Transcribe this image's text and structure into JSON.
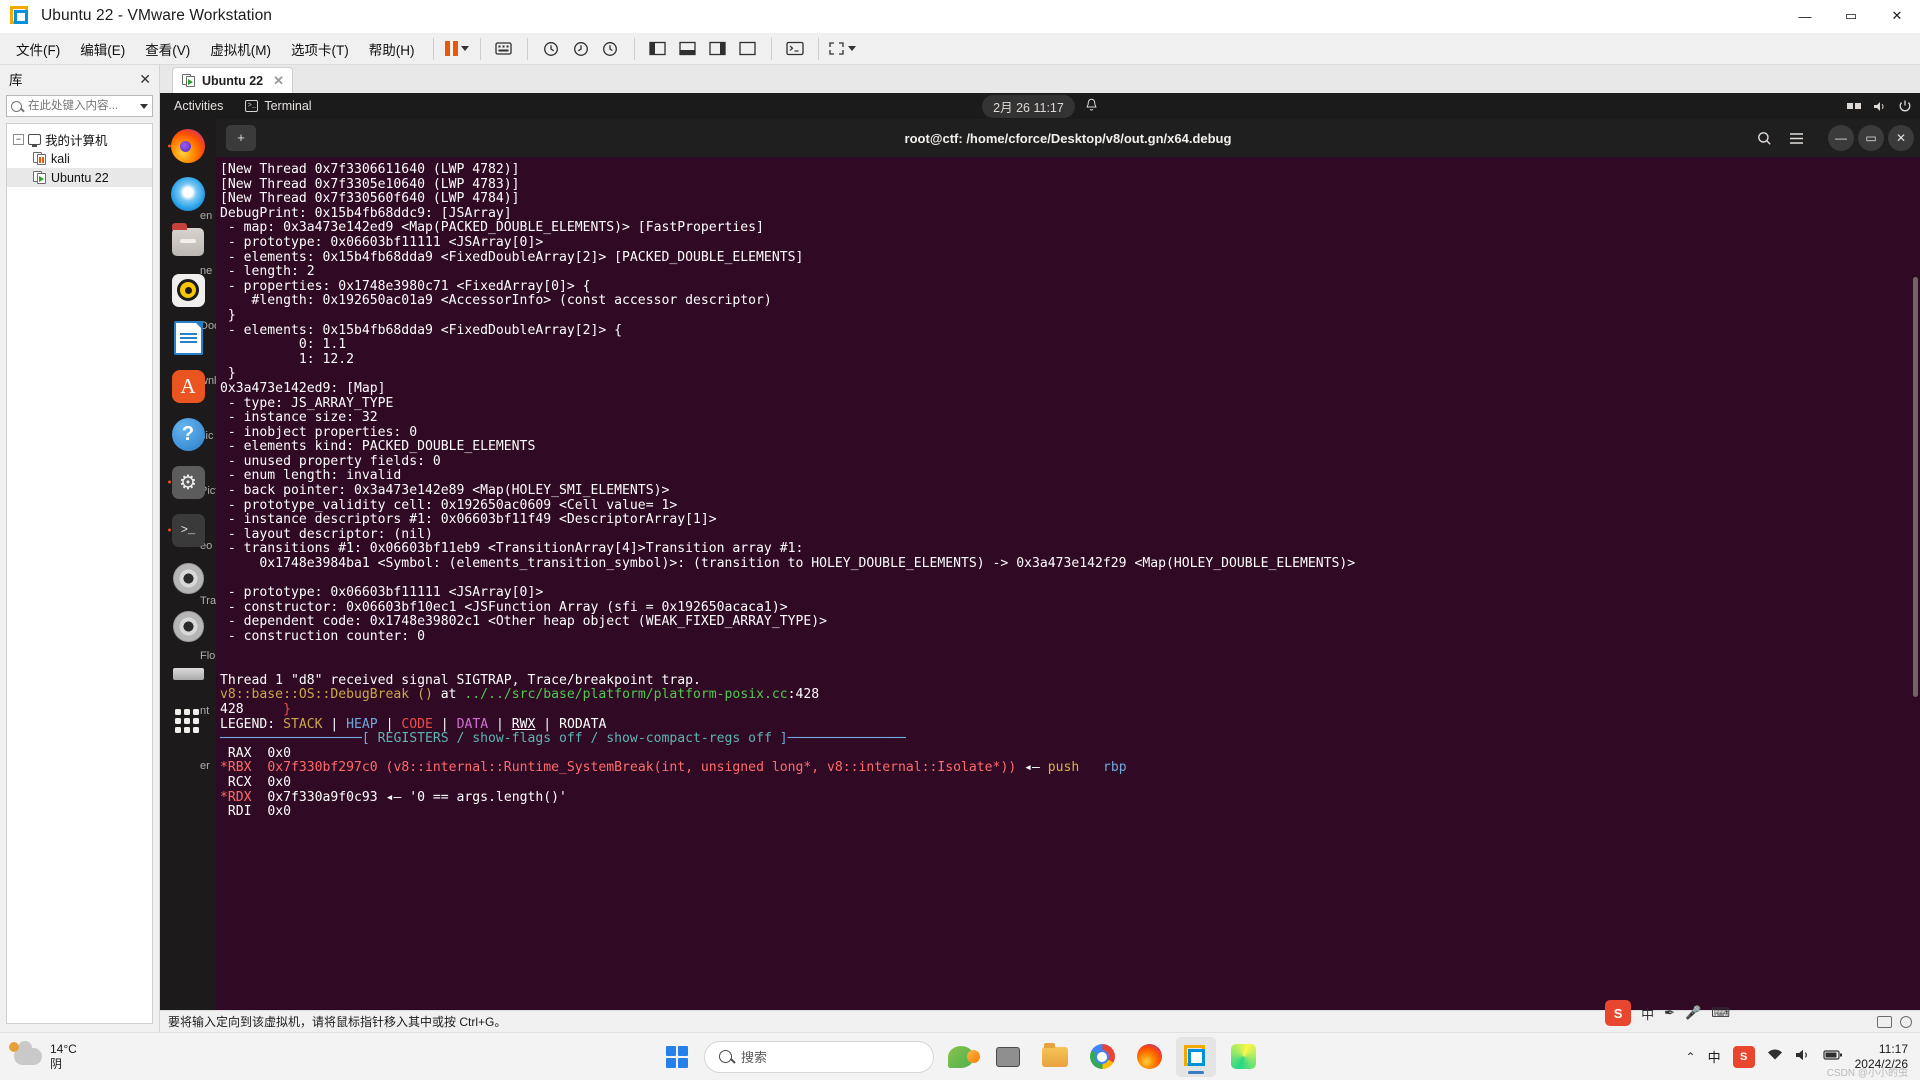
{
  "vmware": {
    "window_title": "Ubuntu 22 - VMware Workstation",
    "window_buttons": {
      "minimize": "—",
      "maximize": "▭",
      "close": "✕"
    },
    "menus": [
      "文件(F)",
      "编辑(E)",
      "查看(V)",
      "虚拟机(M)",
      "选项卡(T)",
      "帮助(H)"
    ],
    "library": {
      "title": "库",
      "close": "✕",
      "search_placeholder": "在此处键入内容...",
      "search_value": "",
      "tree": {
        "root_label": "我的计算机",
        "expander": "−",
        "items": [
          {
            "label": "kali",
            "state": "suspended"
          },
          {
            "label": "Ubuntu 22",
            "state": "running"
          }
        ]
      }
    },
    "tab": {
      "label": "Ubuntu 22",
      "close": "✕"
    },
    "statusbar": {
      "message": "要将输入定向到该虚拟机，请将鼠标指针移入其中或按 Ctrl+G。"
    }
  },
  "guest": {
    "topbar": {
      "activities": "Activities",
      "app_name": "Terminal",
      "clock": "2月 26  11:17",
      "bell": "🔔"
    },
    "dock": [
      {
        "name": "firefox",
        "label": "Firefox",
        "running": true
      },
      {
        "name": "thunderbird",
        "label": "Thunderbird",
        "running": false
      },
      {
        "name": "files",
        "label": "Files",
        "running": false
      },
      {
        "name": "rhythmbox",
        "label": "Rhythmbox",
        "running": false
      },
      {
        "name": "libreoffice-writer",
        "label": "LibreOffice Writer",
        "running": false
      },
      {
        "name": "ubuntu-software",
        "label": "Ubuntu Software",
        "running": false
      },
      {
        "name": "help",
        "label": "Help",
        "running": false
      },
      {
        "name": "settings",
        "label": "Settings",
        "running": true
      },
      {
        "name": "terminal",
        "label": "Terminal",
        "running": true
      },
      {
        "name": "cdrom-1",
        "label": "CD/DVD Drive",
        "running": false
      },
      {
        "name": "cdrom-2",
        "label": "CD/DVD Drive",
        "running": false
      },
      {
        "name": "usb",
        "label": "Removable Drive",
        "running": false
      },
      {
        "name": "show-apps",
        "label": "Show Applications",
        "running": false
      }
    ],
    "desktop_labels": [
      "en",
      "ne",
      "Docum",
      "wnlo",
      "sic",
      "Pictur",
      "eo",
      "Trash",
      "Flopp",
      "nt",
      "er"
    ],
    "terminal": {
      "new_tab_button": "+",
      "title": "root@ctf: /home/cforce/Desktop/v8/out.gn/x64.debug",
      "header_buttons": {
        "search": "🔍",
        "menu": "☰",
        "minimize": "—",
        "maximize": "▭",
        "close": "✕"
      },
      "lines": [
        [
          {
            "t": "[New Thread 0x7f3306611640 (LWP 4782)]",
            "c": "c-white"
          }
        ],
        [
          {
            "t": "[New Thread 0x7f3305e10640 (LWP 4783)]",
            "c": "c-white"
          }
        ],
        [
          {
            "t": "[New Thread 0x7f330560f640 (LWP 4784)]",
            "c": "c-white"
          }
        ],
        [
          {
            "t": "DebugPrint: 0x15b4fb68ddc9: [JSArray]",
            "c": "c-white"
          }
        ],
        [
          {
            "t": " - map: 0x3a473e142ed9 <Map(PACKED_DOUBLE_ELEMENTS)> [FastProperties]",
            "c": "c-white"
          }
        ],
        [
          {
            "t": " - prototype: 0x06603bf11111 <JSArray[0]>",
            "c": "c-white"
          }
        ],
        [
          {
            "t": " - elements: 0x15b4fb68dda9 <FixedDoubleArray[2]> [PACKED_DOUBLE_ELEMENTS]",
            "c": "c-white"
          }
        ],
        [
          {
            "t": " - length: 2",
            "c": "c-white"
          }
        ],
        [
          {
            "t": " - properties: 0x1748e3980c71 <FixedArray[0]> {",
            "c": "c-white"
          }
        ],
        [
          {
            "t": "    #length: 0x192650ac01a9 <AccessorInfo> (const accessor descriptor)",
            "c": "c-white"
          }
        ],
        [
          {
            "t": " }",
            "c": "c-white"
          }
        ],
        [
          {
            "t": " - elements: 0x15b4fb68dda9 <FixedDoubleArray[2]> {",
            "c": "c-white"
          }
        ],
        [
          {
            "t": "          0: 1.1",
            "c": "c-white"
          }
        ],
        [
          {
            "t": "          1: 12.2",
            "c": "c-white"
          }
        ],
        [
          {
            "t": " }",
            "c": "c-white"
          }
        ],
        [
          {
            "t": "0x3a473e142ed9: [Map]",
            "c": "c-white"
          }
        ],
        [
          {
            "t": " - type: JS_ARRAY_TYPE",
            "c": "c-white"
          }
        ],
        [
          {
            "t": " - instance size: 32",
            "c": "c-white"
          }
        ],
        [
          {
            "t": " - inobject properties: 0",
            "c": "c-white"
          }
        ],
        [
          {
            "t": " - elements kind: PACKED_DOUBLE_ELEMENTS",
            "c": "c-white"
          }
        ],
        [
          {
            "t": " - unused property fields: 0",
            "c": "c-white"
          }
        ],
        [
          {
            "t": " - enum length: invalid",
            "c": "c-white"
          }
        ],
        [
          {
            "t": " - back pointer: 0x3a473e142e89 <Map(HOLEY_SMI_ELEMENTS)>",
            "c": "c-white"
          }
        ],
        [
          {
            "t": " - prototype_validity cell: 0x192650ac0609 <Cell value= 1>",
            "c": "c-white"
          }
        ],
        [
          {
            "t": " - instance descriptors #1: 0x06603bf11f49 <DescriptorArray[1]>",
            "c": "c-white"
          }
        ],
        [
          {
            "t": " - layout descriptor: (nil)",
            "c": "c-white"
          }
        ],
        [
          {
            "t": " - transitions #1: 0x06603bf11eb9 <TransitionArray[4]>Transition array #1:",
            "c": "c-white"
          }
        ],
        [
          {
            "t": "     0x1748e3984ba1 <Symbol: (elements_transition_symbol)>: (transition to HOLEY_DOUBLE_ELEMENTS) -> 0x3a473e142f29 <Map(HOLEY_DOUBLE_ELEMENTS)>",
            "c": "c-white"
          }
        ],
        [
          {
            "t": "",
            "c": "c-white"
          }
        ],
        [
          {
            "t": " - prototype: 0x06603bf11111 <JSArray[0]>",
            "c": "c-white"
          }
        ],
        [
          {
            "t": " - constructor: 0x06603bf10ec1 <JSFunction Array (sfi = 0x192650acaca1)>",
            "c": "c-white"
          }
        ],
        [
          {
            "t": " - dependent code: 0x1748e39802c1 <Other heap object (WEAK_FIXED_ARRAY_TYPE)>",
            "c": "c-white"
          }
        ],
        [
          {
            "t": " - construction counter: 0",
            "c": "c-white"
          }
        ],
        [
          {
            "t": "",
            "c": "c-white"
          }
        ],
        [
          {
            "t": "",
            "c": "c-white"
          }
        ],
        [
          {
            "t": "Thread 1 \"d8\" received signal SIGTRAP, Trace/breakpoint trap.",
            "c": "c-white"
          }
        ],
        [
          {
            "t": "v8::base::OS::DebugBreak ()",
            "c": "c-gold"
          },
          {
            "t": " at ",
            "c": "c-white"
          },
          {
            "t": "../../src/base/platform/platform-posix.cc",
            "c": "c-green"
          },
          {
            "t": ":428",
            "c": "c-white"
          }
        ],
        [
          {
            "t": "428     ",
            "c": "c-white"
          },
          {
            "t": "}",
            "c": "c-red"
          }
        ],
        [
          {
            "t": "LEGEND: ",
            "c": "c-white"
          },
          {
            "t": "STACK",
            "c": "c-gold"
          },
          {
            "t": " | ",
            "c": "c-white"
          },
          {
            "t": "HEAP",
            "c": "c-blue"
          },
          {
            "t": " | ",
            "c": "c-white"
          },
          {
            "t": "CODE",
            "c": "c-red"
          },
          {
            "t": " | ",
            "c": "c-white"
          },
          {
            "t": "DATA",
            "c": "c-mag"
          },
          {
            "t": " | ",
            "c": "c-white"
          },
          {
            "t": "RWX",
            "c": "c-white u"
          },
          {
            "t": " | ",
            "c": "c-white"
          },
          {
            "t": "RODATA",
            "c": "c-white"
          }
        ],
        [
          {
            "t": "──────────────────[ ",
            "c": "c-blue"
          },
          {
            "t": "REGISTERS / show-flags off / show-compact-regs off",
            "c": "c-teal"
          },
          {
            "t": " ]───────────────",
            "c": "c-blue"
          }
        ],
        [
          {
            "t": " RAX  ",
            "c": "c-white"
          },
          {
            "t": "0x0",
            "c": "c-white"
          }
        ],
        [
          {
            "t": "*RBX  ",
            "c": "c-lred"
          },
          {
            "t": "0x7f330bf297c0 (v8::internal::Runtime_SystemBreak(int, unsigned long*, v8::internal::Isolate*))",
            "c": "c-lred"
          },
          {
            "t": " ◂— ",
            "c": "c-white"
          },
          {
            "t": "push   ",
            "c": "c-yellow"
          },
          {
            "t": "rbp",
            "c": "c-blue"
          }
        ],
        [
          {
            "t": " RCX  ",
            "c": "c-white"
          },
          {
            "t": "0x0",
            "c": "c-white"
          }
        ],
        [
          {
            "t": "*RDX  ",
            "c": "c-lred"
          },
          {
            "t": "0x7f330a9f0c93 ",
            "c": "c-white"
          },
          {
            "t": "◂— ",
            "c": "c-white"
          },
          {
            "t": "'0 == args.length()'",
            "c": "c-white"
          }
        ],
        [
          {
            "t": " RDI  ",
            "c": "c-white"
          },
          {
            "t": "0x0",
            "c": "c-white"
          }
        ]
      ]
    }
  },
  "taskbar": {
    "weather": {
      "temp": "14°C",
      "condition": "阴"
    },
    "search_placeholder": "搜索",
    "apps": [
      {
        "name": "start",
        "label": "开始"
      },
      {
        "name": "search",
        "label": "搜索"
      },
      {
        "name": "weather-widget",
        "label": "天气"
      },
      {
        "name": "task-view",
        "label": "任务视图"
      },
      {
        "name": "file-explorer",
        "label": "文件资源管理器"
      },
      {
        "name": "google-chrome",
        "label": "Google Chrome"
      },
      {
        "name": "firefox",
        "label": "Firefox"
      },
      {
        "name": "vmware-workstation",
        "label": "VMware Workstation"
      },
      {
        "name": "pycharm",
        "label": "PyCharm"
      }
    ],
    "tray": {
      "chevron": "⌃",
      "ime": "中",
      "sogou": "S",
      "network": "📶",
      "volume": "🔊",
      "battery": "🔋"
    },
    "clock": {
      "time": "11:17",
      "date": "2024/2/26"
    },
    "watermark": "CSDN @小小的虫"
  }
}
